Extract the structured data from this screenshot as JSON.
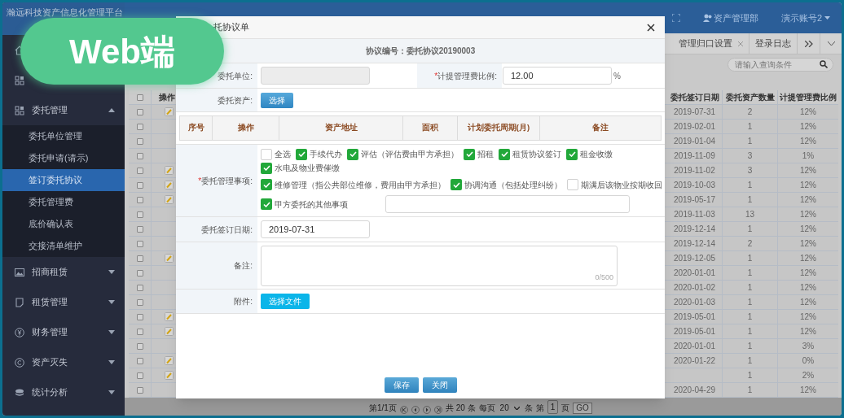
{
  "badge": {
    "text": "Web端"
  },
  "app": {
    "title": "瀚远科技资产信息化管理平台"
  },
  "header": {
    "department": "资产管理部",
    "account": "演示账号2"
  },
  "tabs": [
    {
      "label": "管理归口设置",
      "closable": true
    },
    {
      "label": "登录日志",
      "closable": false
    }
  ],
  "search": {
    "placeholder": "请输入查询条件"
  },
  "sidebar": {
    "items": [
      {
        "label": "委托管理",
        "expanded": true,
        "children": [
          {
            "label": "委托单位管理",
            "selected": false
          },
          {
            "label": "委托申请(请示)",
            "selected": false
          },
          {
            "label": "签订委托协议",
            "selected": true
          },
          {
            "label": "委托管理费",
            "selected": false
          },
          {
            "label": "底价确认表",
            "selected": false
          },
          {
            "label": "交接清单维护",
            "selected": false
          }
        ]
      },
      {
        "label": "招商租赁",
        "expanded": false
      },
      {
        "label": "租赁管理",
        "expanded": false
      },
      {
        "label": "财务管理",
        "expanded": false
      },
      {
        "label": "资产灭失",
        "expanded": false
      },
      {
        "label": "统计分析",
        "expanded": false
      }
    ]
  },
  "table": {
    "columns": [
      "操作",
      "委托签订日期",
      "委托资产数量",
      "计提管理费比例"
    ],
    "all_checked": false,
    "rows": [
      {
        "checked": false,
        "editable": true,
        "date": "2019-07-31",
        "count": "2",
        "rate": "12%"
      },
      {
        "checked": false,
        "editable": false,
        "date": "2019-02-01",
        "count": "1",
        "rate": "12%"
      },
      {
        "checked": false,
        "editable": false,
        "date": "2019-01-04",
        "count": "1",
        "rate": "12%"
      },
      {
        "checked": false,
        "editable": false,
        "date": "2019-11-09",
        "count": "3",
        "rate": "1%"
      },
      {
        "checked": false,
        "editable": true,
        "date": "2019-11-02",
        "count": "3",
        "rate": "12%"
      },
      {
        "checked": false,
        "editable": true,
        "date": "2019-10-03",
        "count": "1",
        "rate": "12%"
      },
      {
        "checked": false,
        "editable": true,
        "date": "2019-05-17",
        "count": "1",
        "rate": "12%"
      },
      {
        "checked": false,
        "editable": false,
        "date": "2019-11-03",
        "count": "13",
        "rate": "12%"
      },
      {
        "checked": false,
        "editable": false,
        "date": "2019-12-14",
        "count": "1",
        "rate": "12%"
      },
      {
        "checked": false,
        "editable": false,
        "date": "2019-12-14",
        "count": "2",
        "rate": "12%"
      },
      {
        "checked": false,
        "editable": true,
        "date": "2019-12-05",
        "count": "1",
        "rate": "12%"
      },
      {
        "checked": false,
        "editable": false,
        "date": "2020-01-01",
        "count": "1",
        "rate": "12%"
      },
      {
        "checked": false,
        "editable": false,
        "date": "2020-01-02",
        "count": "1",
        "rate": "12%"
      },
      {
        "checked": false,
        "editable": false,
        "date": "2020-01-03",
        "count": "1",
        "rate": "12%"
      },
      {
        "checked": false,
        "editable": true,
        "date": "2019-05-01",
        "count": "1",
        "rate": "12%"
      },
      {
        "checked": false,
        "editable": true,
        "date": "2019-05-01",
        "count": "1",
        "rate": "12%"
      },
      {
        "checked": false,
        "editable": false,
        "date": "2020-01-01",
        "count": "1",
        "rate": "3%"
      },
      {
        "checked": false,
        "editable": true,
        "date": "2020-01-22",
        "count": "1",
        "rate": "0%"
      },
      {
        "checked": false,
        "editable": true,
        "count": "1",
        "rate": "2%"
      },
      {
        "checked": false,
        "editable": false,
        "date": "2020-04-29",
        "count": "1",
        "rate": "12%"
      }
    ]
  },
  "pagination": {
    "page": "第1/1页",
    "total": "共 20 条",
    "per_page_label": "每页",
    "per_page": "20",
    "unit": "条",
    "goto_label": "第",
    "goto_value": "1",
    "goto_suffix": "页",
    "go": "GO"
  },
  "modal": {
    "title": "托协议单",
    "agreement_no": "协议编号：委托协议20190003",
    "unit_label": "委托单位:",
    "fee_label": {
      "mark": "*",
      "text": "计提管理费比例:"
    },
    "fee_value": "12.00",
    "fee_unit": "%",
    "assets_label": "委托资产:",
    "select_button": "选择",
    "asset_columns": [
      "序号",
      "操作",
      "资产地址",
      "面积",
      "计划委托周期(月)",
      "备注"
    ],
    "matters_label": {
      "mark": "*",
      "text": "委托管理事项:"
    },
    "matter_rows": [
      [
        {
          "label": "全选",
          "checked": false
        },
        {
          "label": "手续代办",
          "checked": true
        },
        {
          "label": "评估（评估费由甲方承担）",
          "checked": true
        },
        {
          "label": "招租",
          "checked": true
        },
        {
          "label": "租赁协议签订",
          "checked": true
        },
        {
          "label": "租金收缴",
          "checked": true
        },
        {
          "label": "水电及物业费催缴",
          "checked": true
        }
      ],
      [
        {
          "label": "维修管理（指公共部位维修，费用由甲方承担）",
          "checked": true
        },
        {
          "label": "协调沟通（包括处理纠纷）",
          "checked": true
        },
        {
          "label": "期满后该物业按期收回",
          "checked": false
        }
      ],
      [
        {
          "label": "甲方委托的其他事项",
          "checked": true
        }
      ]
    ],
    "date_label": "委托签订日期:",
    "date_value": "2019-07-31",
    "remark_label": "备注:",
    "remark_counter": "0/500",
    "attach_label": "附件:",
    "file_button": "选择文件",
    "buttons": [
      "保存",
      "关闭"
    ]
  }
}
